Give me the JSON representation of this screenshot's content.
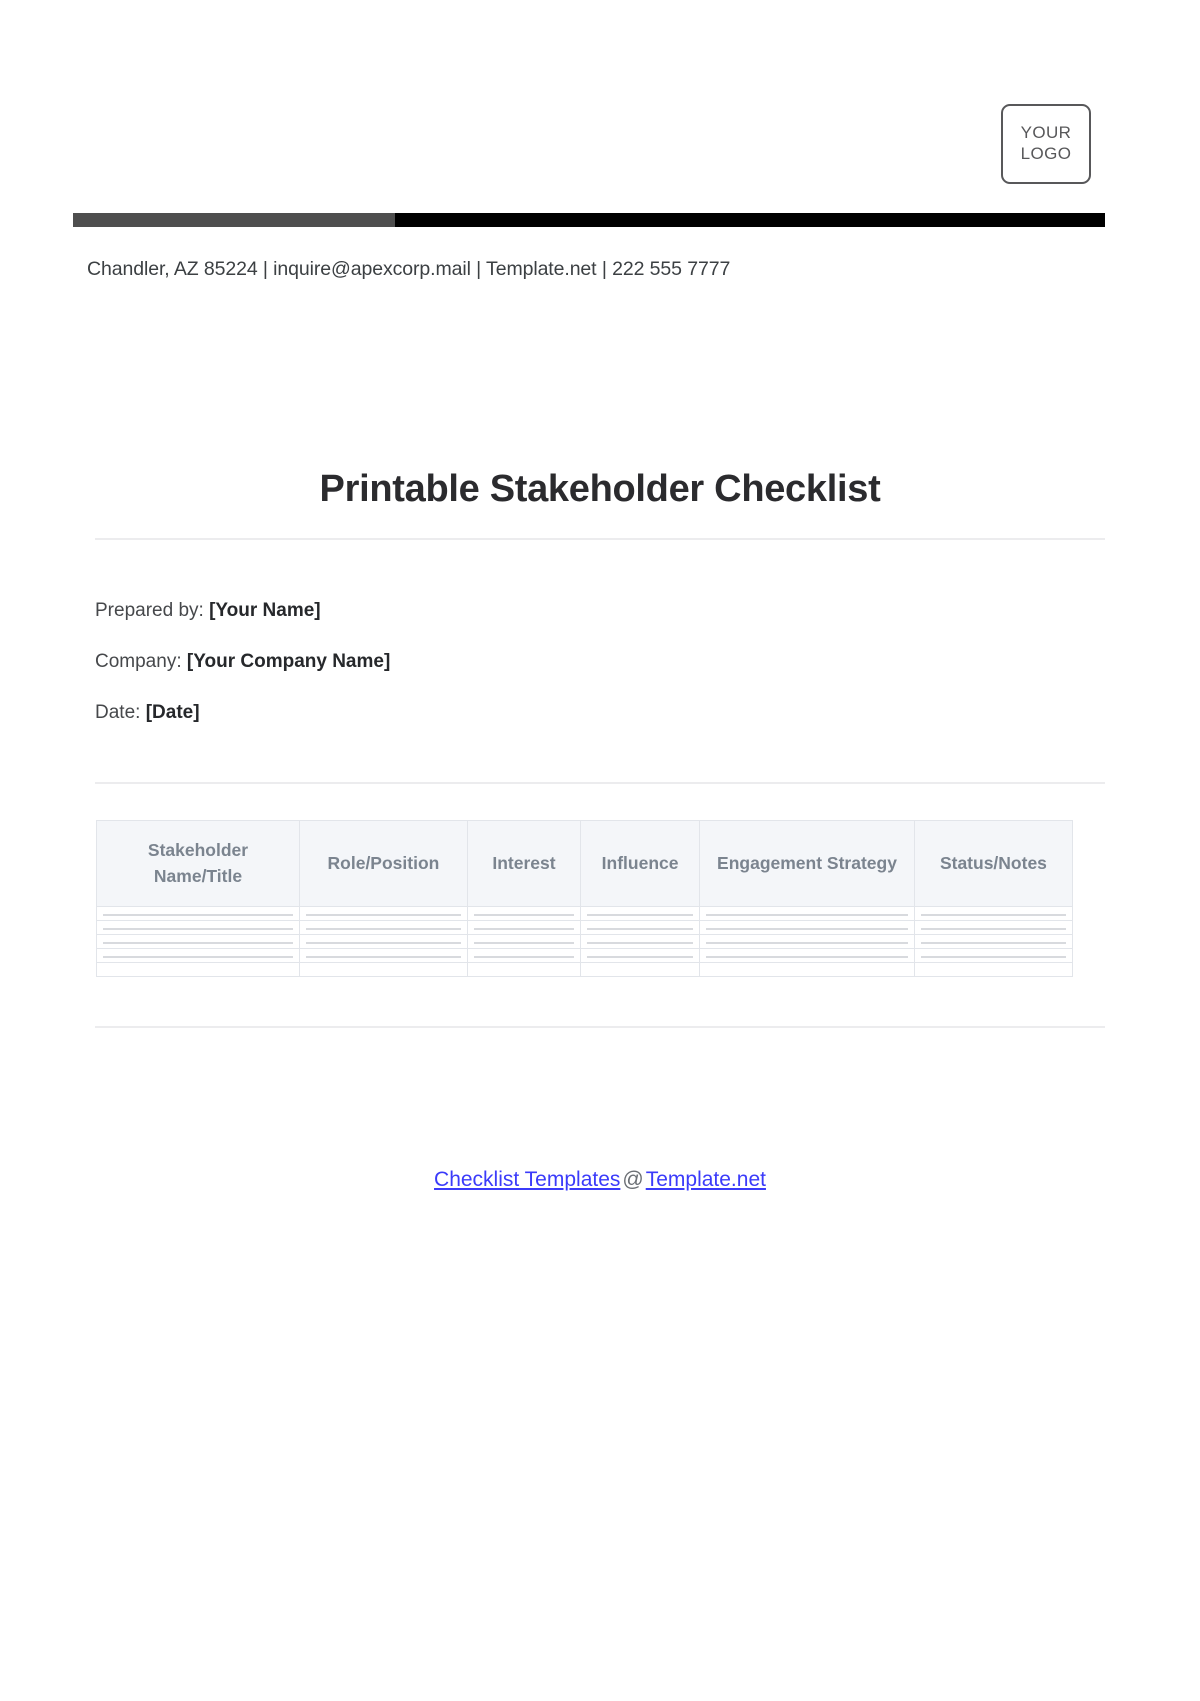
{
  "letterhead": {
    "logo": {
      "line1": "YOUR",
      "line2": "LOGO"
    },
    "bar": {
      "gray_color": "#4e4e4e",
      "black_color": "#000000"
    },
    "contact_line": "Chandler, AZ 85224 | inquire@apexcorp.mail | Template.net | 222 555 7777"
  },
  "document": {
    "title": "Printable Stakeholder Checklist"
  },
  "meta": {
    "prepared_by_label": "Prepared by:",
    "prepared_by_value": "[Your Name]",
    "company_label": "Company:",
    "company_value": "[Your Company Name]",
    "date_label": "Date:",
    "date_value": "[Date]"
  },
  "table": {
    "headers": [
      "Stakeholder Name/Title",
      "Role/Position",
      "Interest",
      "Influence",
      "Engagement Strategy",
      "Status/Notes"
    ],
    "rows": [
      [
        "",
        "",
        "",
        "",
        "",
        ""
      ],
      [
        "",
        "",
        "",
        "",
        "",
        ""
      ],
      [
        "",
        "",
        "",
        "",
        "",
        ""
      ],
      [
        "",
        "",
        "",
        "",
        "",
        ""
      ],
      [
        "",
        "",
        "",
        "",
        "",
        ""
      ]
    ],
    "header_bg": "#f4f6f9",
    "header_text_color": "#7b848f",
    "border_color": "#e2e5ea"
  },
  "footer": {
    "link_primary": "Checklist Templates",
    "separator": "@",
    "link_secondary": "Template.net",
    "link_color": "#3b3bfa"
  }
}
